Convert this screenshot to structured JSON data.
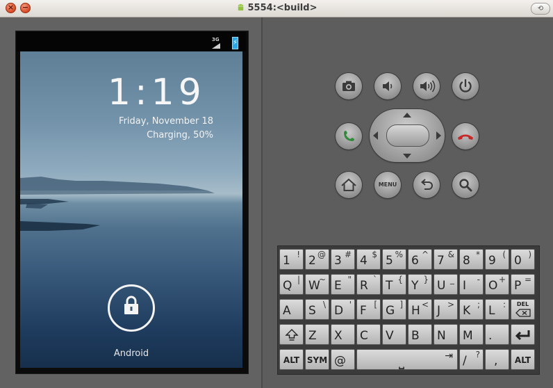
{
  "window": {
    "title": "5554:<build>",
    "close_glyph": "×",
    "minimize_glyph": "−",
    "restore_glyph": "⟲"
  },
  "status_bar": {
    "network": "3G",
    "battery_glyph": "⚡",
    "icons": [
      "signal-icon",
      "battery-charging-icon"
    ]
  },
  "lockscreen": {
    "time": "1:19",
    "date": "Friday, November 18",
    "charging": "Charging, 50%",
    "carrier": "Android"
  },
  "controls": {
    "menu_label": "MENU",
    "buttons": [
      "camera",
      "volume-down",
      "volume-up",
      "power",
      "call",
      "end-call",
      "home",
      "menu",
      "back",
      "search"
    ]
  },
  "keyboard": {
    "row1": [
      {
        "m": "1",
        "s": "!"
      },
      {
        "m": "2",
        "s": "@"
      },
      {
        "m": "3",
        "s": "#"
      },
      {
        "m": "4",
        "s": "$"
      },
      {
        "m": "5",
        "s": "%"
      },
      {
        "m": "6",
        "s": "^"
      },
      {
        "m": "7",
        "s": "&"
      },
      {
        "m": "8",
        "s": "*"
      },
      {
        "m": "9",
        "s": "("
      },
      {
        "m": "0",
        "s": ")"
      }
    ],
    "row2": [
      {
        "m": "Q",
        "s": "|"
      },
      {
        "m": "W",
        "s": "~"
      },
      {
        "m": "E",
        "s": "\""
      },
      {
        "m": "R",
        "s": "`"
      },
      {
        "m": "T",
        "s": "{"
      },
      {
        "m": "Y",
        "s": "}"
      },
      {
        "m": "U",
        "s": "_"
      },
      {
        "m": "I",
        "s": "-"
      },
      {
        "m": "O",
        "s": "+"
      },
      {
        "m": "P",
        "s": "="
      }
    ],
    "row3": [
      {
        "m": "A",
        "s": ""
      },
      {
        "m": "S",
        "s": "\\"
      },
      {
        "m": "D",
        "s": "'"
      },
      {
        "m": "F",
        "s": "["
      },
      {
        "m": "G",
        "s": "]"
      },
      {
        "m": "H",
        "s": "<"
      },
      {
        "m": "J",
        "s": ">"
      },
      {
        "m": "K",
        "s": ";"
      },
      {
        "m": "L",
        "s": ":"
      }
    ],
    "row4": [
      {
        "m": "Z",
        "s": ""
      },
      {
        "m": "X",
        "s": ""
      },
      {
        "m": "C",
        "s": ""
      },
      {
        "m": "V",
        "s": ""
      },
      {
        "m": "B",
        "s": ""
      },
      {
        "m": "N",
        "s": ""
      },
      {
        "m": "M",
        "s": ""
      },
      {
        "m": ".",
        "s": ""
      }
    ],
    "del_label": "DEL",
    "alt_label": "ALT",
    "sym_label": "SYM",
    "at_key": "@",
    "space_glyph": "⎵",
    "tab_glyph": "⇥",
    "slash_key": {
      "m": "/",
      "s": "?"
    },
    "comma_key": ","
  }
}
